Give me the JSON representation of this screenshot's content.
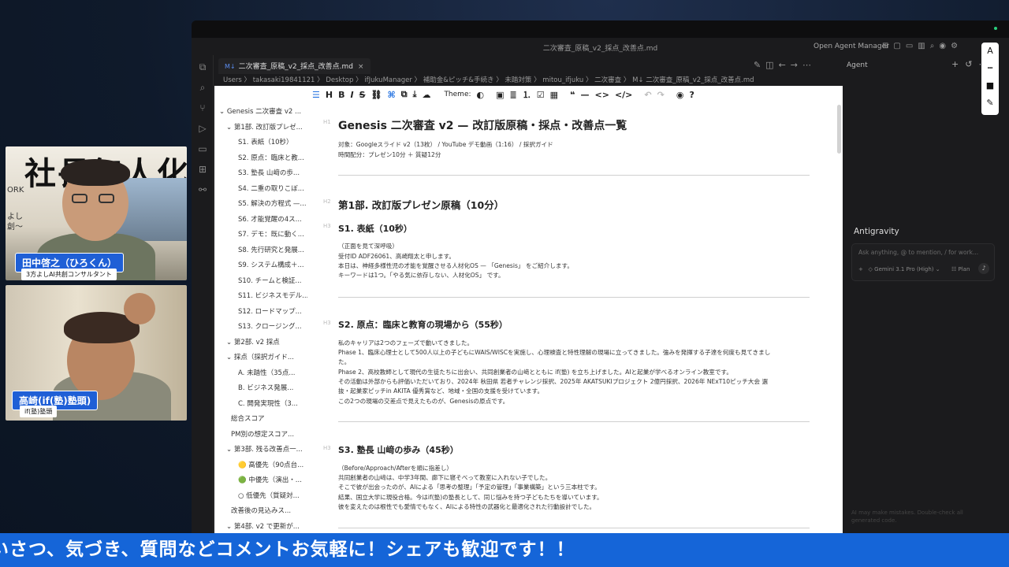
{
  "window": {
    "title": "二次審査_原稿_v2_採点_改善点.md",
    "open_agent_manager": "Open Agent Manager"
  },
  "tab": {
    "label": "二次審査_原稿_v2_採点_改善点.md",
    "badge": "M↓",
    "close": "×"
  },
  "breadcrumb": [
    "Users",
    "takasaki19841121",
    "Desktop",
    "ifJukuManager",
    "補助金&ピッチ&手続き",
    "未踏対策",
    "mitou_ifjuku",
    "二次審査",
    "二次審査_原稿_v2_採点_改善点.md"
  ],
  "breadcrumb_text": "Users 〉 takasaki19841121 〉 Desktop 〉 ifJukuManager 〉 補助金&ピッチ&手続き 〉 未踏対策 〉 mitou_ifjuku 〉 二次審査 〉 M↓ 二次審査_原稿_v2_採点_改善点.md",
  "agent": {
    "header": "Agent",
    "title": "Antigravity",
    "placeholder": "Ask anything, @ to mention, / for work...",
    "model": "Gemini 3.1 Pro (High)",
    "mode": "Plan",
    "disclaimer": "AI may make mistakes. Double-check all generated code."
  },
  "toolbar": {
    "theme_label": "Theme:"
  },
  "outline": [
    "⌄ Genesis 二次審査 v2 ...",
    "⌄ 第1部. 改訂版プレゼ...",
    "S1. 表紙（10秒）",
    "S2. 原点：臨床と教...",
    "S3. 塾長 山﨑の歩...",
    "S4. 二重の取りこぼ...",
    "S5. 解決の方程式 —...",
    "S6. 才能覚醒の4ス...",
    "S7. デモ：既に動く...",
    "S8. 先行研究と発展...",
    "S9. システム構成＋...",
    "S10. チームと検証...",
    "S11. ビジネスモデル...",
    "S12. ロードマップ...",
    "S13. クロージング...",
    "⌄ 第2部. v2 採点",
    "⌄ 採点（採択ガイド...",
    "A. 未踏性（35点...",
    "B. ビジネス発展...",
    "C. 開発実現性（3...",
    "総合スコア",
    "PM別の想定スコア...",
    "⌄ 第3部. 残る改善点一...",
    "🟡 高優先（90点台...",
    "🟢 中優先（演出・...",
    "○ 低優先（質疑対...",
    "改善後の見込みス...",
    "⌄ 第4部. v2 で更新が..."
  ],
  "doc": {
    "title": "Genesis 二次審査 v2 — 改訂版原稿・採点・改善点一覧",
    "meta1": "対象：Googleスライド v2（13枚） / YouTube デモ動画（1:16） / 採択ガイド",
    "meta2": "時間配分：プレゼン10分 ＋ 質疑12分",
    "part1": "第1部. 改訂版プレゼン原稿（10分）",
    "s1_title": "S1. 表紙（10秒）",
    "s1_lines": [
      "（正面を見て深呼吸）",
      "受付ID ADF26061、高崎翔太と申します。",
      "本日は、神経多様性児の才能を覚醒させる人材化OS — 「Genesis」 をご紹介します。",
      "キーワードは1つ。「やる気に依存しない、人材化OS」 です。"
    ],
    "s2_title": "S2. 原点：臨床と教育の現場から（55秒）",
    "s2_lines": [
      "私のキャリアは2つのフェーズで動いてきました。",
      "Phase 1、臨床心理士として500人以上の子どもにWAIS/WISCを実施し、心理検査と特性理解の現場に立ってきました。強みを発揮する子達を何度も見てきまし",
      "た。",
      "Phase 2、高校教師として現代の生徒たちに出会い、共同創業者の山﨑とともに if(塾) を立ち上げました。AIと起業が学べるオンライン教室です。",
      "その活動は外部からも評価いただいており、2024年 秋田県 若者チャレンジ採択、2025年 AKATSUKIプロジェクト 2億円採択、2026年 NExT10ピッチ大会 選",
      "抜・起業家ピッチin AKITA 優秀賞など、地域・全国の支援を受けています。",
      "この2つの現場の交差点で見えたものが、Genesisの原点です。"
    ],
    "s3_title": "S3. 塾長 山﨑の歩み（45秒）",
    "s3_lines": [
      "（Before/Approach/Afterを順に指差し）",
      "共同創業者の山﨑は、中学3年間、廊下に寝そべって教室に入れない子でした。",
      "そこで彼が出会ったのが、AIによる「思考の整理」「予定の管理」「事業構築」という三本柱です。",
      "結果、国立大学に現役合格。今はif(塾)の塾長として、同じ悩みを持つ子どもたちを導いています。",
      "彼を変えたのは根性でも愛情でもなく、AIによる特性の武器化と最適化された行動設計でした。"
    ]
  },
  "participants": [
    {
      "name": "田中啓之（ひろくん）",
      "role": "3方よしAI共創コンサルタント",
      "sign": "社長無人化",
      "side1": "ORK",
      "side2": "よし",
      "side3": "創〜"
    },
    {
      "name": "高崎(if(塾)塾頭)",
      "role": "if(塾)塾頭"
    }
  ],
  "ticker": "いさつ、気づき、質問などコメントお気軽に！シェアも歓迎です！！",
  "colors": {
    "accent": "#1565d8",
    "editor_bg": "#ffffff",
    "ide_bg": "#1b1b1d"
  }
}
